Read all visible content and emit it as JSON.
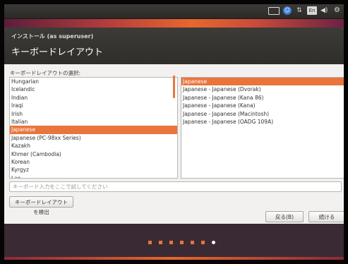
{
  "tray": {
    "a11y": "☺",
    "network": "⇅",
    "language": "En",
    "volume": "◀)",
    "settings": "⚙"
  },
  "window": {
    "title": "インストール (as superuser)",
    "page_title": "キーボードレイアウト"
  },
  "layout_section_label": "キーボードレイアウトの選択:",
  "layouts": [
    "Hungarian",
    "Icelandic",
    "Indian",
    "Iraqi",
    "Irish",
    "Italian",
    "Japanese",
    "Japanese (PC-98xx Series)",
    "Kazakh",
    "Khmer (Cambodia)",
    "Korean",
    "Kyrgyz",
    "Lao"
  ],
  "selected_layout": "Japanese",
  "variants": [
    "Japanese",
    "Japanese - Japanese (Dvorak)",
    "Japanese - Japanese (Kana 86)",
    "Japanese - Japanese (Kana)",
    "Japanese - Japanese (Macintosh)",
    "Japanese - Japanese (OADG 109A)"
  ],
  "selected_variant": "Japanese",
  "test_input": {
    "value": "",
    "placeholder": "キーボード入力をここで試してください"
  },
  "buttons": {
    "detect": "キーボードレイアウトを検出",
    "back": "戻る(B)",
    "continue": "続ける"
  },
  "progress": {
    "total_steps": 7,
    "current_step": 7
  },
  "colors": {
    "accent": "#e9753d",
    "titlebar": "#3c3b37",
    "window_bg": "#f2f1f0"
  }
}
